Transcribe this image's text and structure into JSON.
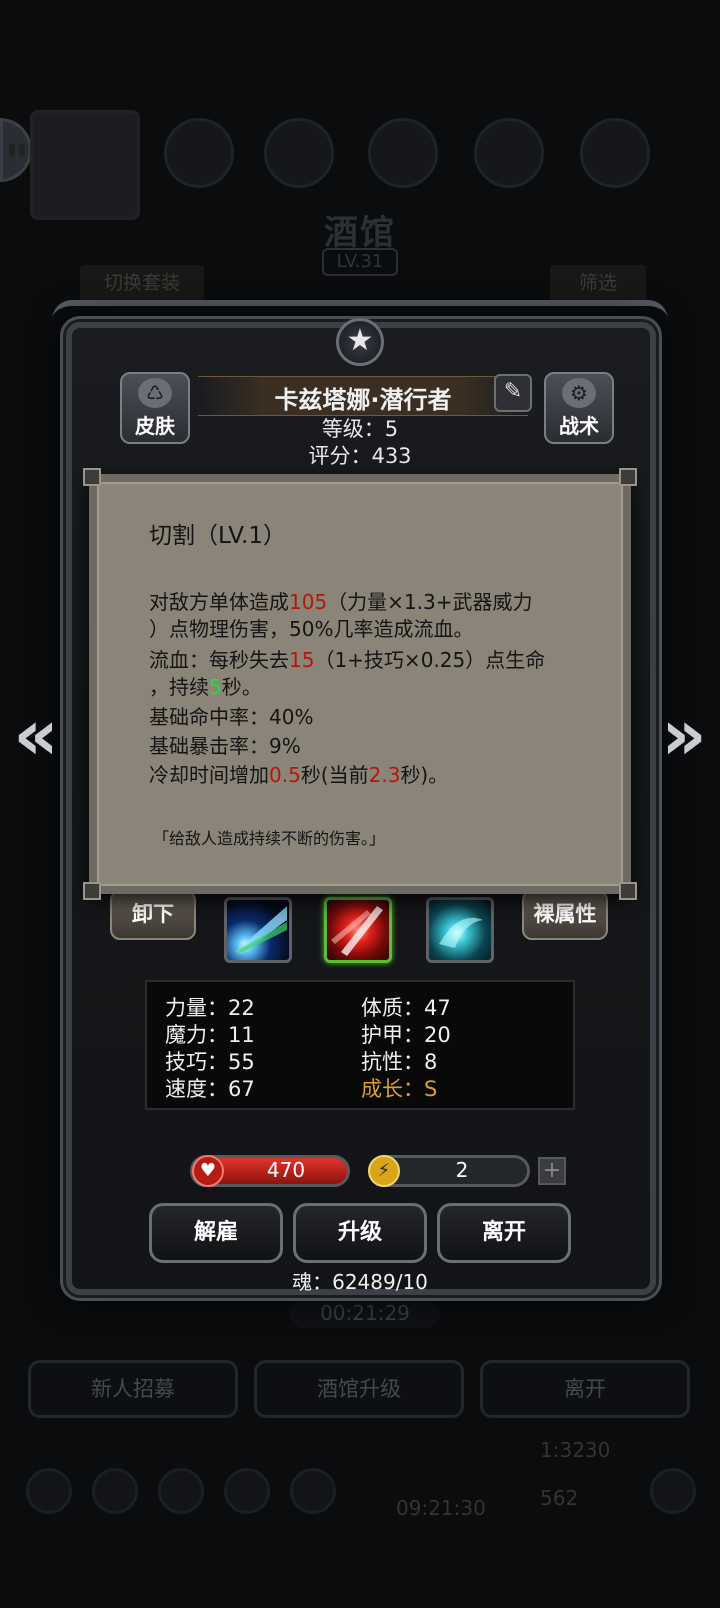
{
  "background": {
    "title": "酒馆",
    "tavern_level": "LV.31",
    "switch_outfit": "切换套装",
    "filter": "筛选",
    "timer": "00:21:29",
    "buttons": [
      "新人招募",
      "酒馆升级",
      "离开"
    ],
    "dock": {
      "clock": "09:21:30",
      "resource_a": "1:3230",
      "resource_b": "562"
    }
  },
  "hero": {
    "name": "卡兹塔娜·潜行者",
    "level_text": "等级：5",
    "score_text": "评分：433",
    "skin_label": "皮肤",
    "tactics_label": "战术"
  },
  "tooltip": {
    "title": "切割（LV.1）",
    "line1": {
      "a": "对敌方单体造成",
      "b": "105",
      "c": "（力量×1.3+武器威力"
    },
    "line2": "）点物理伤害，50%几率造成流血。",
    "line3": {
      "a": "流血：每秒失去",
      "b": "15",
      "c": "（1+技巧×0.25）点生命"
    },
    "line4": {
      "a": "，持续",
      "b": "5",
      "c": "秒。"
    },
    "line5": "基础命中率：40%",
    "line6": "基础暴击率：9%",
    "line7": {
      "a": "冷却时间增加",
      "b": "0.5",
      "c": "秒(当前",
      "d": "2.3",
      "e": "秒)。"
    },
    "flavor": "「给敌人造成持续不断的伤害。」"
  },
  "equip": {
    "unequip_label": "卸下",
    "base_attr_label": "裸属性",
    "skills": [
      {
        "icon": "light-beam-skill-icon"
      },
      {
        "icon": "red-slash-skill-icon",
        "selected": true
      },
      {
        "icon": "cyan-swirl-skill-icon"
      }
    ]
  },
  "stats": {
    "strength": "力量：22",
    "magic": "魔力：11",
    "skill": "技巧：55",
    "speed": "速度：67",
    "constitution": "体质：47",
    "armor": "护甲：20",
    "resistance": "抗性：8",
    "growth": "成长：S"
  },
  "bars": {
    "hp": "470",
    "energy": "2",
    "plus": "+"
  },
  "actions": {
    "dismiss": "解雇",
    "upgrade": "升级",
    "leave": "离开"
  },
  "soul_text": "魂：62489/10",
  "colors": {
    "damage_red": "#b3180c",
    "duration_green": "#2eda33",
    "growth_gold": "#d9a12b",
    "tooltip_bg": "#8b8478"
  }
}
